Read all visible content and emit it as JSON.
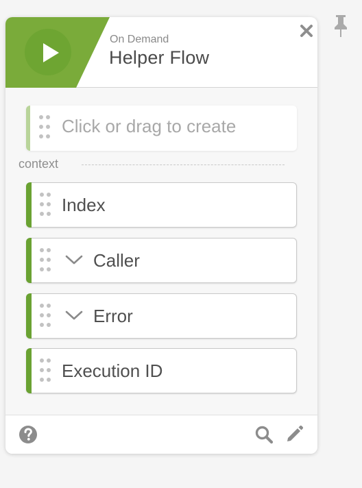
{
  "header": {
    "flow_type": "On Demand",
    "flow_name": "Helper Flow",
    "accent_color": "#7aab3a",
    "play_button_color": "#6ea532"
  },
  "slots": {
    "placeholder": {
      "label": "Click or drag to create"
    },
    "section_label": "context",
    "items": [
      {
        "label": "Index",
        "expandable": false
      },
      {
        "label": "Caller",
        "expandable": true
      },
      {
        "label": "Error",
        "expandable": true
      },
      {
        "label": "Execution ID",
        "expandable": false
      }
    ],
    "accent_color": "#6aa232"
  },
  "icons": {
    "pin": "pin-icon",
    "close": "close-icon",
    "play": "play-icon",
    "grip": "drag-handle-icon",
    "chevron": "chevron-down-icon",
    "help": "help-icon",
    "search": "search-icon",
    "edit": "pencil-icon"
  }
}
